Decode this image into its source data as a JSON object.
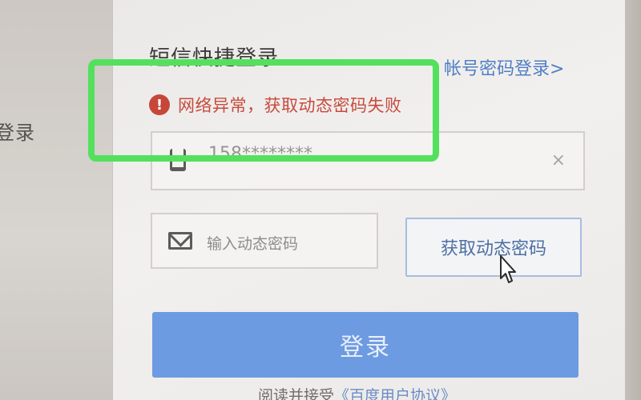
{
  "left_panel": {
    "label": "登录"
  },
  "panel": {
    "title": "短信快捷登录",
    "account_login_link": "帐号密码登录>"
  },
  "error": {
    "icon": "exclamation-circle-icon",
    "message": "网络异常，获取动态密码失败"
  },
  "phone_input": {
    "icon": "phone-icon",
    "value": "158********",
    "clear_icon": "×"
  },
  "code_input": {
    "icon": "mail-icon",
    "placeholder": "输入动态密码"
  },
  "get_code_button": {
    "label": "获取动态密码"
  },
  "login_button": {
    "label": "登录"
  },
  "agreement": {
    "prefix": "阅读并接受",
    "link": "《百度用户协议》"
  },
  "colors": {
    "error": "#c74a3d",
    "link": "#4f7fc6",
    "primary_button": "#6d9be2",
    "highlight_box": "#53e15d"
  }
}
